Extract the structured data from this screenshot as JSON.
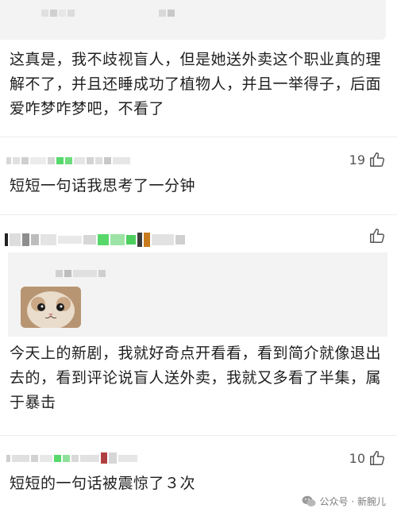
{
  "comment_1": {
    "text": "这真是，我不歧视盲人，但是她送外卖这个职业真的理解不了，并且还睡成功了植物人，并且一举得子，后面爱咋梦咋梦吧，不看了"
  },
  "comment_2": {
    "likes": "19",
    "text": "短短一句话我思考了一分钟"
  },
  "comment_3": {
    "text": "今天上的新剧，我就好奇点开看看，看到简介就像退出去的，看到评论说盲人送外卖，我就又多看了半集，属于暴击"
  },
  "comment_4": {
    "likes": "10",
    "text": "短短的一句话被震惊了３次"
  },
  "watermark": {
    "text": "公众号 · 新腕儿",
    "icon": "wechat-icon"
  },
  "icons": {
    "like": "thumbs-up-icon"
  },
  "colors": {
    "mosaic_gray": "#d7d7d7",
    "mosaic_green": "#57d86a",
    "panel_bg": "#f3f3f3"
  }
}
